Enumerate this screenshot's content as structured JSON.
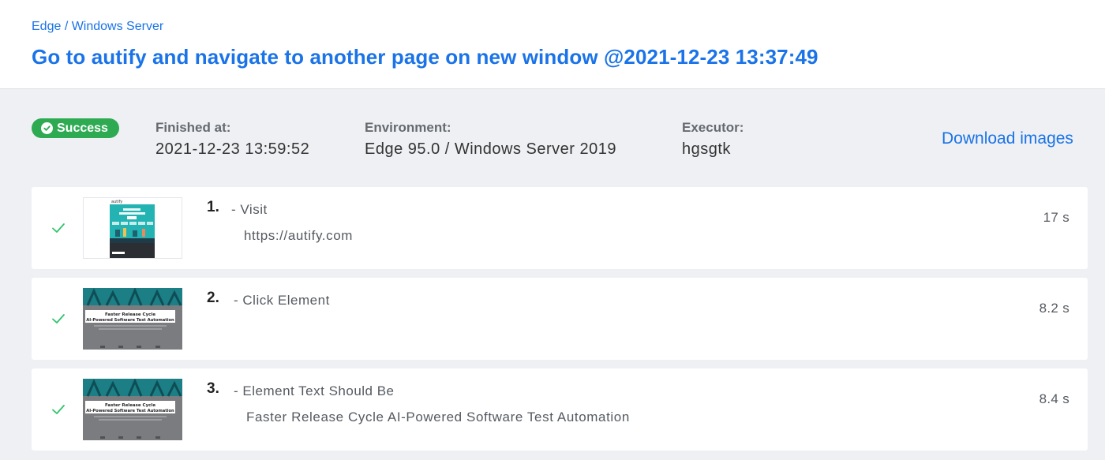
{
  "header": {
    "breadcrumb": "Edge / Windows Server",
    "title": "Go to autify and navigate to another page on new window @2021-12-23 13:37:49"
  },
  "summary": {
    "status": "Success",
    "finished_label": "Finished at:",
    "finished_value": "2021-12-23 13:59:52",
    "environment_label": "Environment:",
    "environment_value": "Edge 95.0 / Windows Server 2019",
    "executor_label": "Executor:",
    "executor_value": "hgsgtk",
    "download_label": "Download images"
  },
  "steps": [
    {
      "number": "1.",
      "title": "- Visit",
      "detail": "https://autify.com",
      "duration": "17 s",
      "status": "passed",
      "thumb_logo": "autify"
    },
    {
      "number": "2.",
      "title": "- Click Element",
      "detail": "",
      "duration": "8.2 s",
      "status": "passed",
      "thumb_text_1": "Faster Release Cycle",
      "thumb_text_2": "AI-Powered Software Test Automation"
    },
    {
      "number": "3.",
      "title": "- Element Text Should Be",
      "detail": "Faster Release Cycle AI-Powered Software Test Automation",
      "duration": "8.4 s",
      "status": "passed",
      "thumb_text_1": "Faster Release Cycle",
      "thumb_text_2": "AI-Powered Software Test Automation"
    }
  ],
  "colors": {
    "accent": "#1a73e8",
    "success": "#2eaa52",
    "check": "#2ec46b",
    "background": "#eef0f3"
  },
  "icons": {
    "badge": "check-circle-icon",
    "step_status": "check-icon"
  }
}
